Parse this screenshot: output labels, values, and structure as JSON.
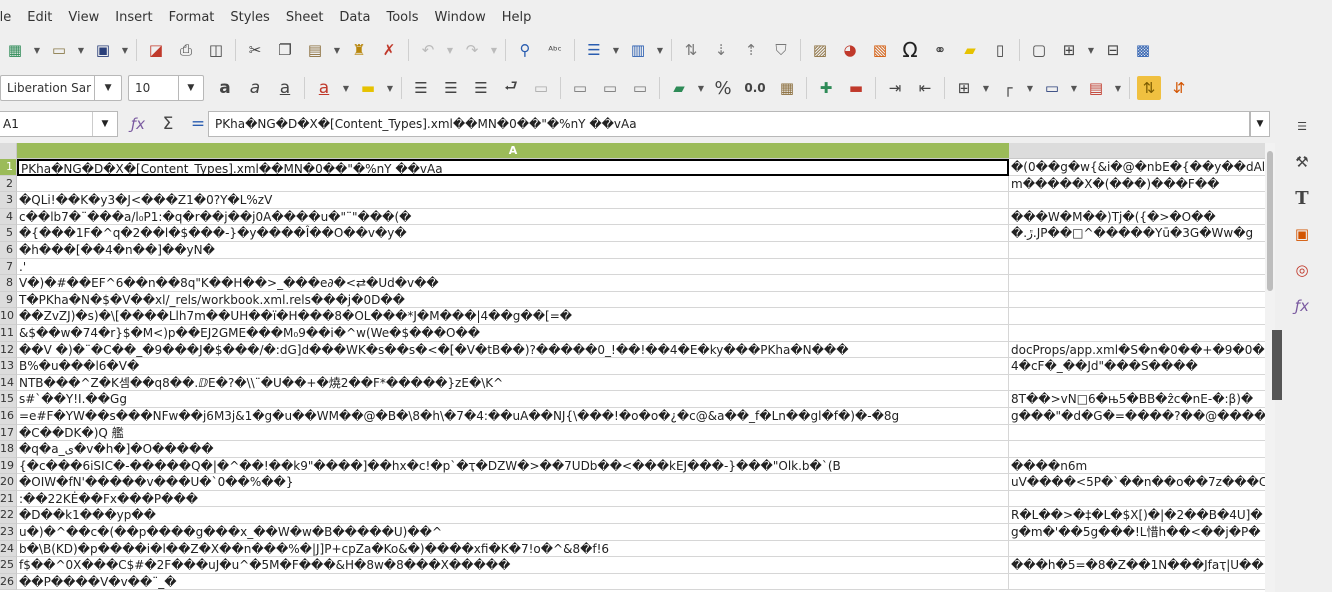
{
  "menu": [
    "ile",
    "Edit",
    "View",
    "Insert",
    "Format",
    "Styles",
    "Sheet",
    "Data",
    "Tools",
    "Window",
    "Help"
  ],
  "toolbar": {
    "font_name": "Liberation Sar",
    "font_size": "10",
    "percent_label": "%",
    "number_label": "0.0"
  },
  "formula_bar": {
    "name_box": "A1",
    "content": "PKha�NG�D�X�[Content_Types].xml��MN�0��\"�%nY ��vAa"
  },
  "columns": [
    "A",
    "B"
  ],
  "rows": [
    {
      "n": "1",
      "a": "PKha�NG�D�X�[Content_Types].xml��MN�0��\"�%nY ��vAa",
      "b": "�(0��g�w{&i�@�nbE�{��y��dAl"
    },
    {
      "n": "2",
      "a": "",
      "b": "m�����X�(���)���F��"
    },
    {
      "n": "3",
      "a": "�QLi!��K�y3�J<���Z1�0?Y�L%zV",
      "b": ""
    },
    {
      "n": "4",
      "a": "c��lb7�¨���a/l₀P1:�q�r��j��j0A����u�\"¨\"���(�",
      "b": "���W�M��)Tj�({�>�O��"
    },
    {
      "n": "5",
      "a": "�{���1F�^q�2��l�$���-}�y����Î��O��v�y�",
      "b": "�.ڙ.JP��□^�����Yū�3G�Ww�g"
    },
    {
      "n": "6",
      "a": "�h���[��4�n��]��yN�",
      "b": ""
    },
    {
      "n": "7",
      "a": ".'",
      "b": ""
    },
    {
      "n": "8",
      "a": "V�)�#��EF^6��n��8q\"K��H��>_���e∂�<⇄�Ud�v��",
      "b": ""
    },
    {
      "n": "9",
      "a": "T�PKha�N�$�V��xl/_rels/workbook.xml.rels���j�0D��",
      "b": ""
    },
    {
      "n": "10",
      "a": "��ZvZJ)�s)�\\[����Llh7m��UH��ï�H���8�OL���*J�M���|4��g��[=�",
      "b": ""
    },
    {
      "n": "11",
      "a": "&$��w�74�r}$�M<)p��EJ2GME���M₀9��i�^w(We�$���O��",
      "b": ""
    },
    {
      "n": "12",
      "a": "��V �)�¨�C��_�9���J�$���/�:dG]d���WK�s��s�<�[�V�tB��)?�����0_!��!��4�E�ky���PKha�N���",
      "b": "docProps/app.xml�S�n�0��+�9�0�"
    },
    {
      "n": "13",
      "a": "B%�u���l6�V�",
      "b": "4�cF�_��Jd\"���S����"
    },
    {
      "n": "14",
      "a": " NTB���^Z�K셈��q8��.ⅅE�?�\\\\¨�U��+�燒2��F*�����}zE�\\K^",
      "b": ""
    },
    {
      "n": "15",
      "a": "s#`��Y!I.��Gg",
      "b": "8T��>vN□6�њ5�BB�ẑc�nE-�:β)�"
    },
    {
      "n": "16",
      "a": "=e#F�YW��s���NFw��j6M3j&1�g�u��WM��@�B�\\8�h\\�7�4:��uA��NJ{\\���!�o�o�¿�c@&a��_f�Ln��gl�f�)�-�8g",
      "b": "g���\"�d�G�=����?��@����"
    },
    {
      "n": "17",
      "a": "�C��DK�)Q 艦",
      "b": ""
    },
    {
      "n": "18",
      "a": "�q�a_ی�v�h�]�O�����",
      "b": ""
    },
    {
      "n": "19",
      "a": "{�c���6iSIC�-�����Q�|�^��!��k9\"����]��hx�c!�p`�ҭ�DZW�>��7UDb��<���kEJ���-}���\"Olk.b�`(B",
      "b": "����n6m"
    },
    {
      "n": "20",
      "a": "�OIW�fN'�����v���U�`0��%��}",
      "b": "uV����<5P�`��n��o��7z���C"
    },
    {
      "n": "21",
      "a": ":��22KĖ��Fx���P���",
      "b": ""
    },
    {
      "n": "22",
      "a": "�D��k1���yp��",
      "b": "R�L��>�‡�L�$X[)�|�2��B�4U]�"
    },
    {
      "n": "23",
      "a": "u�)�^��c�(��p����g���x_��W�w�B�����U)��^",
      "b": "g�m�'��5g���!L惜h��<��j�P�"
    },
    {
      "n": "24",
      "a": "b�\\B(KD)�p����i�l��Z�X��n���%�|J]P+cpZa�Ko&�)����xfi�K�7!o�^&8�f!6",
      "b": ""
    },
    {
      "n": "25",
      "a": "f$��^0X���C$#�2F���uJ�u^�5M�F���&H�8w�8���X�����",
      "b": "���h�5=�8�Z��1N���Jfaҭ|U��"
    },
    {
      "n": "26",
      "a": "��P����V�v��¨_�",
      "b": ""
    }
  ]
}
